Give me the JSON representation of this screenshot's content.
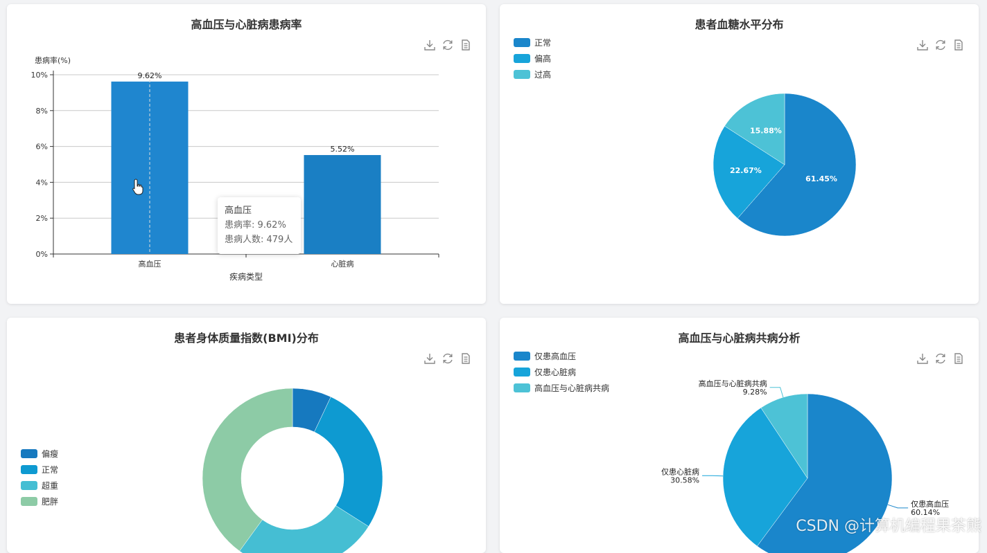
{
  "toolbox_icons": [
    "download-icon",
    "refresh-icon",
    "data-view-icon"
  ],
  "charts": [
    {
      "title": "高血压与心脏病患病率",
      "chart_data": {
        "type": "bar",
        "categories": [
          "高血压",
          "心脏病"
        ],
        "values": [
          9.62,
          5.52
        ],
        "value_labels": [
          "9.62%",
          "5.52%"
        ],
        "ylabel": "患病率(%)",
        "xlabel": "疾病类型",
        "ylim": [
          0,
          10
        ],
        "yticks": [
          "0%",
          "2%",
          "4%",
          "6%",
          "8%",
          "10%"
        ],
        "ytick_values": [
          0,
          2,
          4,
          6,
          8,
          10
        ],
        "grid": true,
        "colors": [
          "#1f86cf",
          "#1a7fc4"
        ]
      },
      "tooltip": {
        "title": "高血压",
        "line1": "患病率: 9.62%",
        "line2": "患病人数: 479人"
      }
    },
    {
      "title": "患者血糖水平分布",
      "chart_data": {
        "type": "pie",
        "labels": [
          "正常",
          "偏高",
          "过高"
        ],
        "values": [
          61.45,
          22.67,
          15.88
        ],
        "value_labels": [
          "61.45%",
          "22.67%",
          "15.88%"
        ],
        "colors": [
          "#1a86cb",
          "#17a4da",
          "#4dc2d6"
        ],
        "legend": "top-left"
      }
    },
    {
      "title": "患者身体质量指数(BMI)分布",
      "chart_data": {
        "type": "pie",
        "donut": true,
        "labels": [
          "偏瘦",
          "正常",
          "超重",
          "肥胖"
        ],
        "values": [
          7,
          27,
          26,
          40
        ],
        "colors": [
          "#1679bf",
          "#0e9ad1",
          "#45bed3",
          "#8dcba6"
        ],
        "legend": "left"
      }
    },
    {
      "title": "高血压与心脏病共病分析",
      "chart_data": {
        "type": "pie",
        "labels": [
          "仅患高血压",
          "仅患心脏病",
          "高血压与心脏病共病"
        ],
        "values": [
          60.14,
          30.58,
          9.28
        ],
        "value_labels": [
          "60.14%",
          "30.58%",
          "9.28%"
        ],
        "colors": [
          "#1a86cb",
          "#17a4da",
          "#4dc2d6"
        ],
        "legend": "top-left"
      }
    }
  ],
  "watermark": "CSDN @计算机编程果茶熊"
}
